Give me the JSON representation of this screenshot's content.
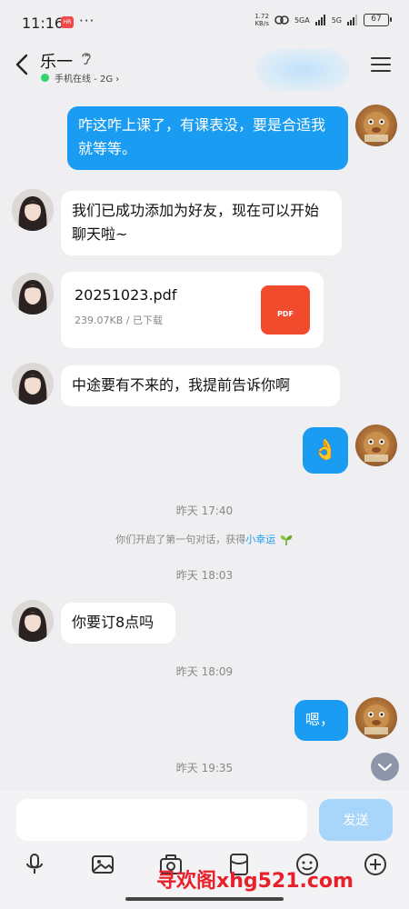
{
  "status_bar": {
    "time": "11:16",
    "app_badge": "HR",
    "dots": "···",
    "speed": "1.72",
    "speed_unit": "KB/s",
    "network": "5GA",
    "network2": "5G",
    "battery": "67"
  },
  "header": {
    "contact_name": "乐一",
    "online_status": "手机在线 - 2G",
    "online_color": "#2fd46b"
  },
  "messages": [
    {
      "from": "me",
      "text": "咋这咋上课了，有课表没，要是合适我就等等。"
    },
    {
      "from": "other",
      "text": "我们已成功添加为好友，现在可以开始聊天啦~"
    },
    {
      "from": "other",
      "type": "file",
      "file_name": "20251023.pdf",
      "file_meta": "239.07KB / 已下载",
      "file_icon_label": "PDF"
    },
    {
      "from": "other",
      "text": "中途要有不来的，我提前告诉你啊"
    },
    {
      "from": "me",
      "type": "emoji",
      "text": "👌"
    },
    {
      "from": "other",
      "text": "你要订8点吗"
    },
    {
      "from": "me",
      "text": "嗯，"
    }
  ],
  "timestamps": [
    "昨天 17:40",
    "昨天 18:03",
    "昨天 18:09",
    "昨天 19:35"
  ],
  "system_notice": {
    "prefix": "你们开启了第一句对话，获得",
    "link": "小幸运",
    "icon": "sprout-icon"
  },
  "input": {
    "placeholder": "",
    "send_label": "发送"
  },
  "toolbar": {
    "icons": [
      "microphone-icon",
      "image-icon",
      "camera-icon",
      "red-packet-icon",
      "emoji-icon",
      "plus-icon"
    ]
  },
  "watermark": "寻欢阁xhg521.com",
  "colors": {
    "accent": "#1a9cf2",
    "send_disabled": "#a8d6fa",
    "background": "#efeff2",
    "watermark": "#e8202a"
  }
}
